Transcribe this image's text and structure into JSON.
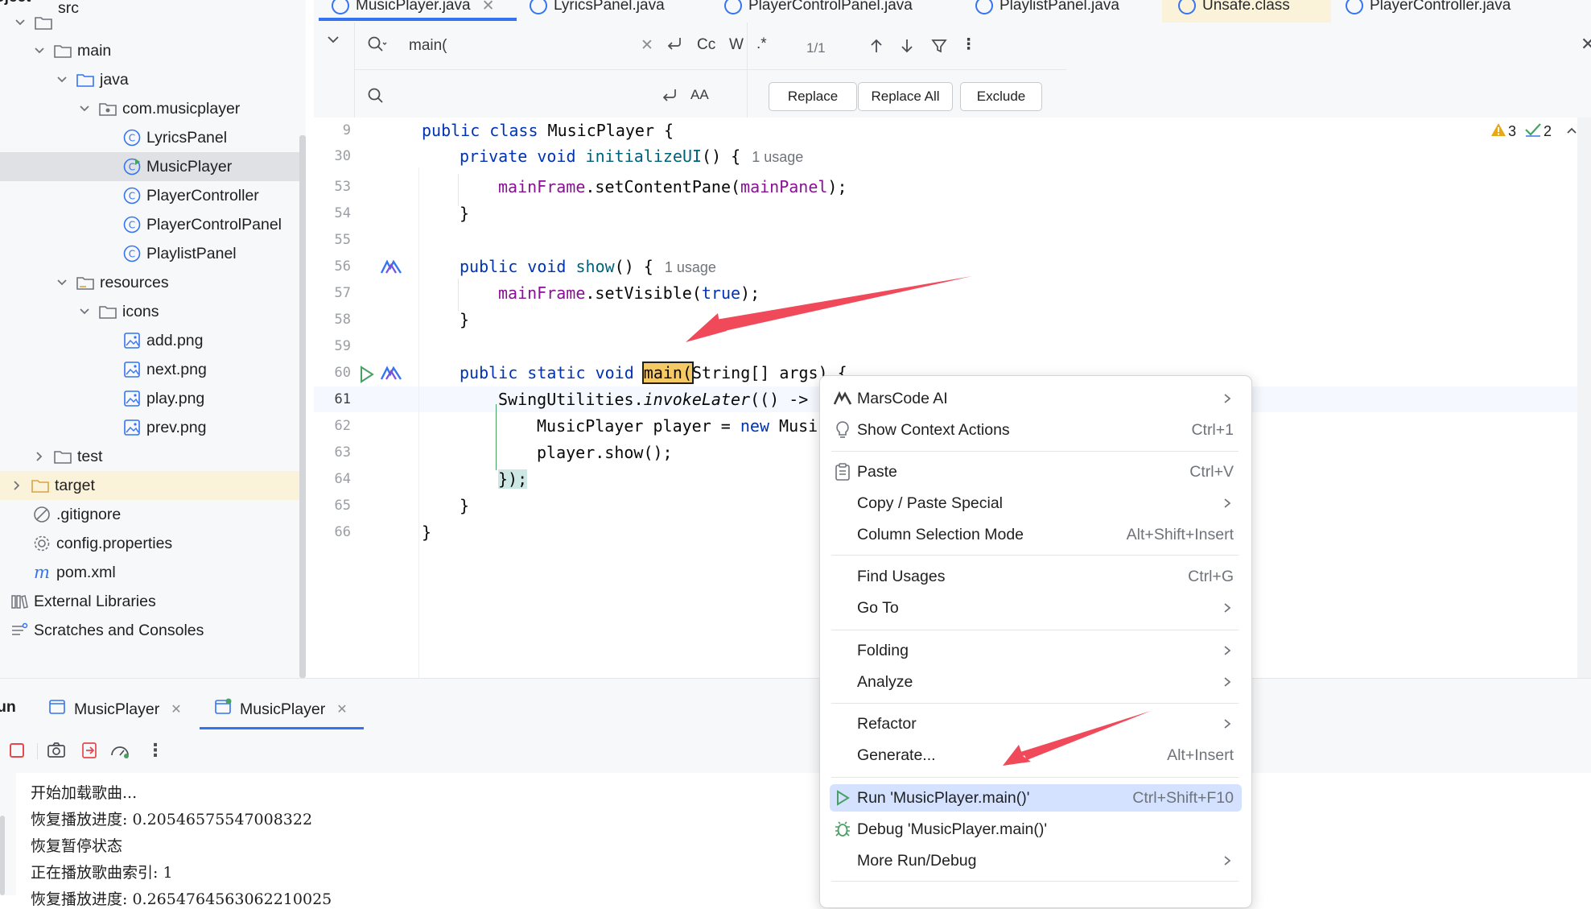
{
  "project": {
    "title": "oject",
    "items": [
      {
        "label": "src"
      },
      {
        "label": "main"
      },
      {
        "label": "java"
      },
      {
        "label": "com.musicplayer"
      },
      {
        "label": "LyricsPanel"
      },
      {
        "label": "MusicPlayer"
      },
      {
        "label": "PlayerController"
      },
      {
        "label": "PlayerControlPanel"
      },
      {
        "label": "PlaylistPanel"
      },
      {
        "label": "resources"
      },
      {
        "label": "icons"
      },
      {
        "label": "add.png"
      },
      {
        "label": "next.png"
      },
      {
        "label": "play.png"
      },
      {
        "label": "prev.png"
      },
      {
        "label": "test"
      },
      {
        "label": "target"
      },
      {
        "label": ".gitignore"
      },
      {
        "label": "config.properties"
      },
      {
        "label": "pom.xml"
      },
      {
        "label": "External Libraries"
      },
      {
        "label": "Scratches and Consoles"
      }
    ]
  },
  "tabs": [
    "MusicPlayer.java",
    "LyricsPanel.java",
    "PlayerControlPanel.java",
    "PlaylistPanel.java",
    "Unsafe.class",
    "PlayerController.java"
  ],
  "find": {
    "query": "main(",
    "case_label": "Cc",
    "word_label": "W",
    "regex_label": ".*",
    "match_count": "1/1",
    "replace_btn": "Replace",
    "replace_all_btn": "Replace All",
    "exclude_btn": "Exclude"
  },
  "inspections": {
    "warnings": "3",
    "checks": "2"
  },
  "editor": {
    "lines": [
      {
        "n": "9"
      },
      {
        "n": "30"
      },
      {
        "n": "53"
      },
      {
        "n": "54"
      },
      {
        "n": "55"
      },
      {
        "n": "56"
      },
      {
        "n": "57"
      },
      {
        "n": "58"
      },
      {
        "n": "59"
      },
      {
        "n": "60"
      },
      {
        "n": "61"
      },
      {
        "n": "62"
      },
      {
        "n": "63"
      },
      {
        "n": "64"
      },
      {
        "n": "65"
      },
      {
        "n": "66"
      }
    ],
    "code": {
      "l9_kw": "public class ",
      "l9_name": "MusicPlayer {",
      "l30_kw": "private void ",
      "l30_fn": "initializeUI",
      "l30_rest": "() {",
      "l30_hint": "1 usage",
      "l53_fld": "mainFrame",
      "l53_mid": ".setContentPane(",
      "l53_fld2": "mainPanel",
      "l53_end": ");",
      "l54": "}",
      "l56_kw": "public void ",
      "l56_fn": "show",
      "l56_rest": "() {",
      "l56_hint": "1 usage",
      "l57_fld": "mainFrame",
      "l57_mid": ".setVisible(",
      "l57_kw": "true",
      "l57_end": ");",
      "l58": "}",
      "l60_kw": "public static void ",
      "l60_main": "main(",
      "l60_rest": "String[] args) {",
      "l61_a": "SwingUtilities.",
      "l61_b": "invokeLater",
      "l61_c": "(() ->",
      "l62_a": "MusicPlayer player = ",
      "l62_kw": "new",
      "l62_b": " Musi",
      "l63": "player.show();",
      "l64": "});",
      "l65": "}",
      "l66": "}"
    }
  },
  "run": {
    "label": "un",
    "tabs": [
      "MusicPlayer",
      "MusicPlayer"
    ],
    "console": [
      "开始加载歌曲...",
      "恢复播放进度: 0.20546575547008322",
      "恢复暂停状态",
      "正在播放歌曲索引: 1",
      "恢复播放进度: 0.2654764563062210025"
    ]
  },
  "menu": {
    "items": [
      {
        "label": "MarsCode AI",
        "shortcut": "",
        "icon": "marscode-icon"
      },
      {
        "label": "Show Context Actions",
        "shortcut": "Ctrl+1",
        "icon": "bulb-icon"
      },
      {
        "label": "Paste",
        "shortcut": "Ctrl+V",
        "icon": "paste-icon"
      },
      {
        "label": "Copy / Paste Special",
        "shortcut": ""
      },
      {
        "label": "Column Selection Mode",
        "shortcut": "Alt+Shift+Insert"
      },
      {
        "label": "Find Usages",
        "shortcut": "Ctrl+G"
      },
      {
        "label": "Go To",
        "shortcut": ""
      },
      {
        "label": "Folding",
        "shortcut": ""
      },
      {
        "label": "Analyze",
        "shortcut": ""
      },
      {
        "label": "Refactor",
        "shortcut": ""
      },
      {
        "label": "Generate...",
        "shortcut": "Alt+Insert"
      },
      {
        "label": "Run 'MusicPlayer.main()'",
        "shortcut": "Ctrl+Shift+F10",
        "icon": "run-icon"
      },
      {
        "label": "Debug 'MusicPlayer.main()'",
        "shortcut": "",
        "icon": "debug-icon"
      },
      {
        "label": "More Run/Debug",
        "shortcut": ""
      }
    ]
  },
  "colors": {
    "accent": "#3574f0",
    "annotation_arrow": "#f0495a",
    "selected_menu": "#d4e2ff",
    "keyword": "#0033b3"
  }
}
